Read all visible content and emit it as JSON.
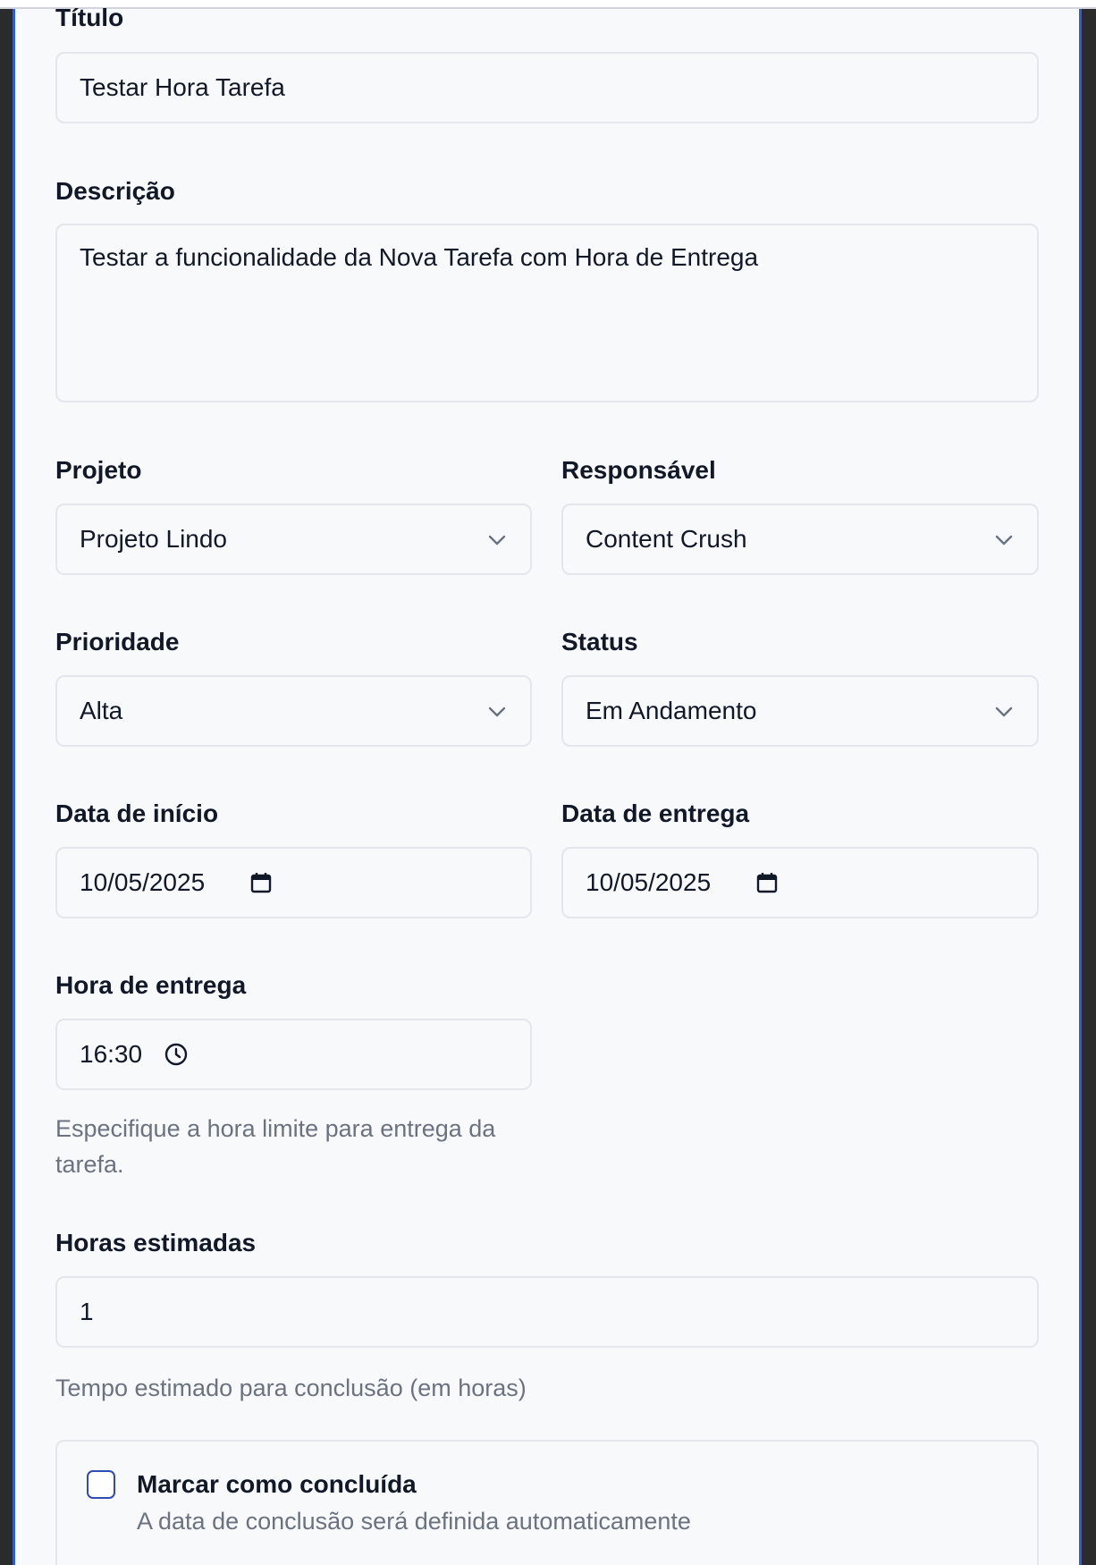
{
  "form": {
    "title_label": "Título",
    "title_value": "Testar Hora Tarefa",
    "description_label": "Descrição",
    "description_value": "Testar a funcionalidade da Nova Tarefa com Hora de Entrega",
    "project_label": "Projeto",
    "project_value": "Projeto Lindo",
    "assignee_label": "Responsável",
    "assignee_value": "Content Crush",
    "priority_label": "Prioridade",
    "priority_value": "Alta",
    "status_label": "Status",
    "status_value": "Em Andamento",
    "start_date_label": "Data de início",
    "start_date_value": "10/05/2025",
    "due_date_label": "Data de entrega",
    "due_date_value": "10/05/2025",
    "due_time_label": "Hora de entrega",
    "due_time_value": "16:30",
    "due_time_help": "Especifique a hora limite para entrega da tarefa.",
    "estimated_hours_label": "Horas estimadas",
    "estimated_hours_value": "1",
    "estimated_hours_help": "Tempo estimado para conclusão (em horas)",
    "complete_label": "Marcar como concluída",
    "complete_hint": "A data de conclusão será definida automaticamente",
    "complete_checked": false
  },
  "colors": {
    "accent": "#2f5bd3",
    "field_border": "#e3e6ea",
    "help_text": "#6b7280",
    "background": "#f8f9fb"
  },
  "icons": {
    "select": "chevron-down-icon",
    "date": "calendar-icon",
    "time": "clock-icon"
  }
}
